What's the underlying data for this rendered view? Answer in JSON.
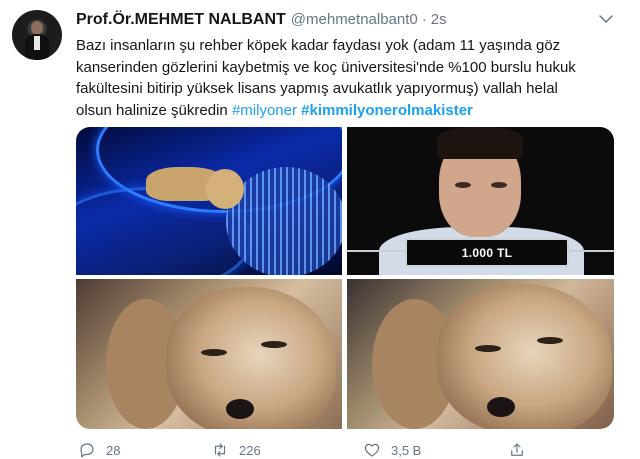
{
  "tweet": {
    "author_name": "Prof.Ör.MEHMET NALBANT",
    "handle": "@mehmetnalbant0",
    "separator": "·",
    "time": "2s",
    "text_lines": [
      "Bazı insanların şu rehber köpek kadar faydası yok (adam 11 yaşında göz",
      "kanserinden gözlerini kaybetmiş ve koç üniversitesi'nde %100 burslu hukuk",
      "fakültesini bitirip yüksek lisans yapmış avukatlık yapıyormuş) vallah helal",
      "olsun halinize şükredin "
    ],
    "hashtags": [
      "#milyoner",
      "#kimmilyonerolmakister"
    ],
    "media": {
      "money_label": "1.000 TL"
    },
    "actions": {
      "reply_count": "28",
      "retweet_count": "226",
      "like_count": "3,5 B"
    }
  },
  "icons": {
    "caret": "chevron-down-icon",
    "reply": "reply-icon",
    "retweet": "retweet-icon",
    "like": "heart-icon",
    "share": "share-icon"
  },
  "colors": {
    "hashtag": "#1da1f2",
    "secondary_text": "#657786",
    "primary_text": "#14171a"
  }
}
